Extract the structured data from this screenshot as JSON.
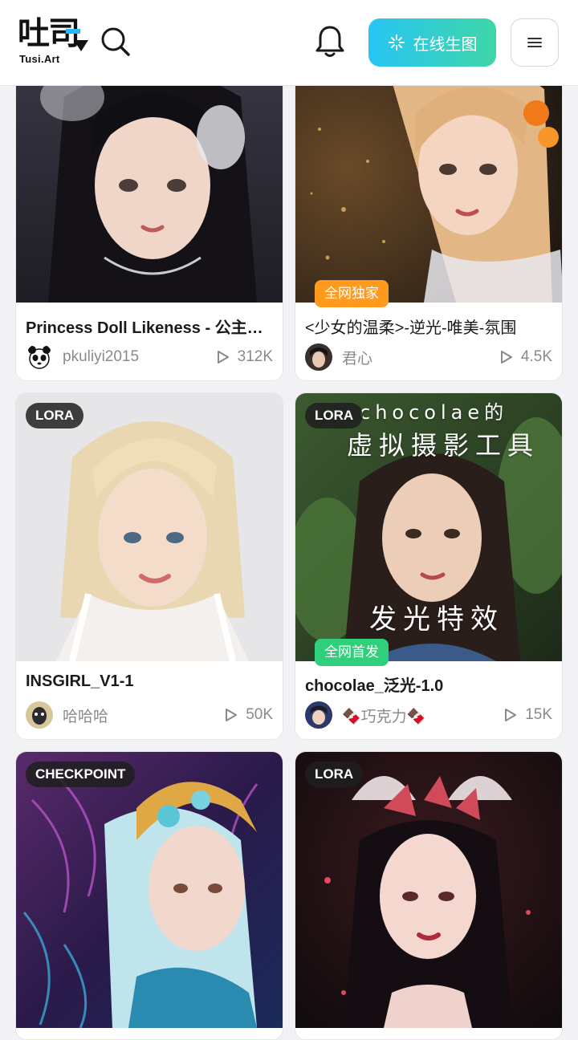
{
  "header": {
    "logo_text": "吐司",
    "logo_sub": "Tusi.Art",
    "generate_label": "在线生图",
    "icons": [
      "search-icon",
      "bell-icon",
      "sparkle-icon",
      "menu-icon"
    ]
  },
  "cards": [
    {
      "title": "Princess Doll Likeness - 公主娃娃",
      "author": "pkuliyi2015",
      "runs": "312K",
      "type_badge": "",
      "tag": ""
    },
    {
      "title": "<少女的温柔>-逆光-唯美-氛围",
      "author": "君心",
      "runs": "4.5K",
      "type_badge": "",
      "tag": "全网独家"
    },
    {
      "title": "INSGIRL_V1-1",
      "author": "哈哈哈",
      "runs": "50K",
      "type_badge": "LORA",
      "tag": ""
    },
    {
      "title": "chocolae_泛光-1.0",
      "author": "🍫巧克力🍫",
      "runs": "15K",
      "type_badge": "LORA",
      "tag": "全网首发",
      "overlay_lines": [
        "chocolae的",
        "虚拟摄影工具",
        "发光特效"
      ]
    },
    {
      "type_badge": "CHECKPOINT"
    },
    {
      "type_badge": "LORA"
    }
  ],
  "colors": {
    "accent_start": "#27c5f5",
    "accent_end": "#3fd6a6",
    "tag_orange": "#ff9a1f",
    "tag_green": "#2fcf7b"
  }
}
